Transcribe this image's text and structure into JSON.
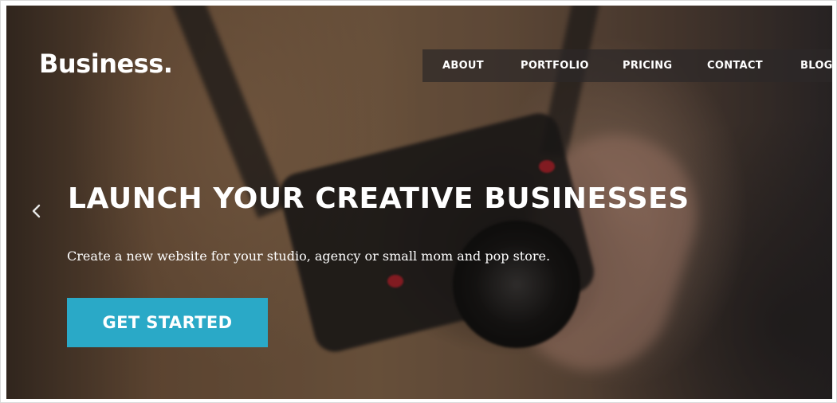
{
  "brand": {
    "logo_text": "Business."
  },
  "nav": {
    "items": [
      {
        "label": "ABOUT"
      },
      {
        "label": "PORTFOLIO"
      },
      {
        "label": "PRICING"
      },
      {
        "label": "CONTACT"
      },
      {
        "label": "BLOG"
      }
    ]
  },
  "hero": {
    "headline": "LAUNCH YOUR CREATIVE BUSINESSES",
    "subtext": "Create a new website for your studio, agency or small mom and pop store.",
    "cta_label": "GET STARTED",
    "prev_icon": "chevron-left-icon"
  },
  "colors": {
    "cta_background": "#2aa9c7",
    "nav_background": "#2d2828",
    "text": "#ffffff"
  }
}
